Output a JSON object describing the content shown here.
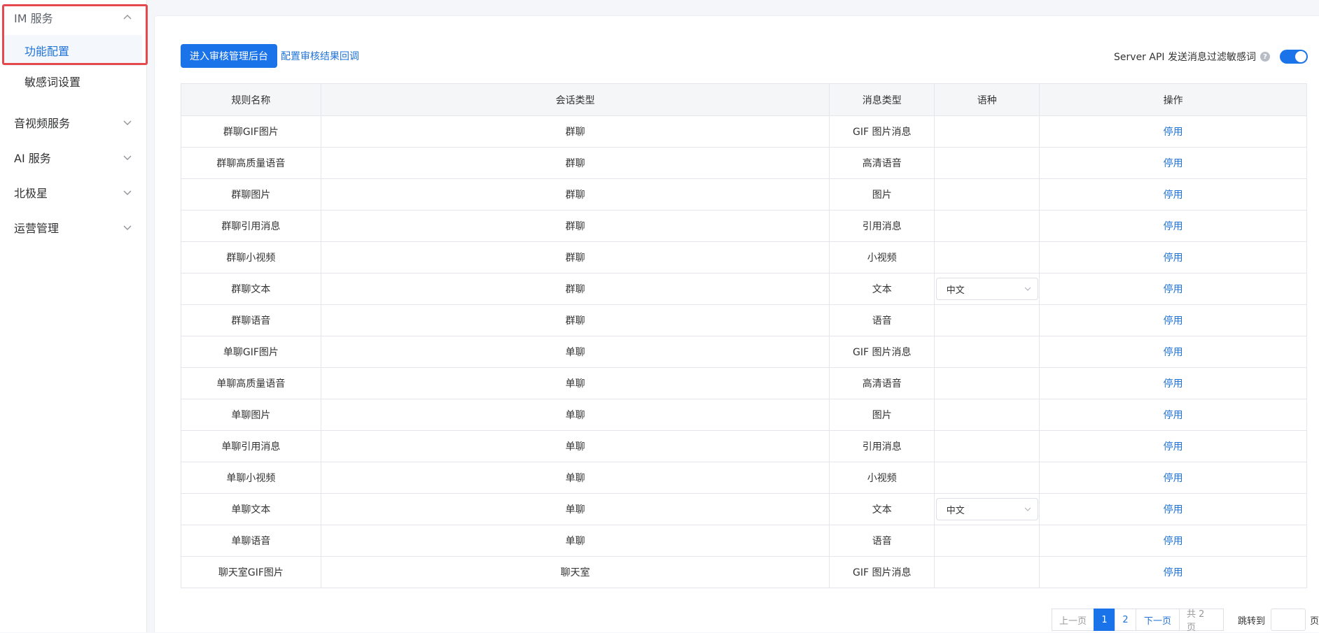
{
  "sidebar": {
    "im_service": "IM 服务",
    "feature_config": "功能配置",
    "sensitive_words": "敏感词设置",
    "av_service": "音视频服务",
    "ai_service": "AI 服务",
    "polaris": "北极星",
    "ops_management": "运营管理"
  },
  "toolbar": {
    "enter_review_label": "进入审核管理后台",
    "callback_link": "配置审核结果回调",
    "filter_label": "Server API 发送消息过滤敏感词",
    "filter_enabled": true
  },
  "table": {
    "headers": [
      "规则名称",
      "会话类型",
      "消息类型",
      "语种",
      "操作"
    ],
    "rows": [
      {
        "name": "群聊GIF图片",
        "session": "群聊",
        "msg": "GIF 图片消息",
        "lang": "",
        "action": "停用"
      },
      {
        "name": "群聊高质量语音",
        "session": "群聊",
        "msg": "高清语音",
        "lang": "",
        "action": "停用"
      },
      {
        "name": "群聊图片",
        "session": "群聊",
        "msg": "图片",
        "lang": "",
        "action": "停用"
      },
      {
        "name": "群聊引用消息",
        "session": "群聊",
        "msg": "引用消息",
        "lang": "",
        "action": "停用"
      },
      {
        "name": "群聊小视频",
        "session": "群聊",
        "msg": "小视频",
        "lang": "",
        "action": "停用"
      },
      {
        "name": "群聊文本",
        "session": "群聊",
        "msg": "文本",
        "lang": "中文",
        "action": "停用"
      },
      {
        "name": "群聊语音",
        "session": "群聊",
        "msg": "语音",
        "lang": "",
        "action": "停用"
      },
      {
        "name": "单聊GIF图片",
        "session": "单聊",
        "msg": "GIF 图片消息",
        "lang": "",
        "action": "停用"
      },
      {
        "name": "单聊高质量语音",
        "session": "单聊",
        "msg": "高清语音",
        "lang": "",
        "action": "停用"
      },
      {
        "name": "单聊图片",
        "session": "单聊",
        "msg": "图片",
        "lang": "",
        "action": "停用"
      },
      {
        "name": "单聊引用消息",
        "session": "单聊",
        "msg": "引用消息",
        "lang": "",
        "action": "停用"
      },
      {
        "name": "单聊小视频",
        "session": "单聊",
        "msg": "小视频",
        "lang": "",
        "action": "停用"
      },
      {
        "name": "单聊文本",
        "session": "单聊",
        "msg": "文本",
        "lang": "中文",
        "action": "停用"
      },
      {
        "name": "单聊语音",
        "session": "单聊",
        "msg": "语音",
        "lang": "",
        "action": "停用"
      },
      {
        "name": "聊天室GIF图片",
        "session": "聊天室",
        "msg": "GIF 图片消息",
        "lang": "",
        "action": "停用"
      }
    ]
  },
  "pagination": {
    "prev": "上一页",
    "pages": [
      "1",
      "2"
    ],
    "current": "1",
    "next": "下一页",
    "total": "共 2 页",
    "jump_label": "跳转到",
    "jump_suffix": "页"
  },
  "colors": {
    "primary": "#1a73e8",
    "link": "#1f73d6",
    "highlight": "#e5484d"
  }
}
